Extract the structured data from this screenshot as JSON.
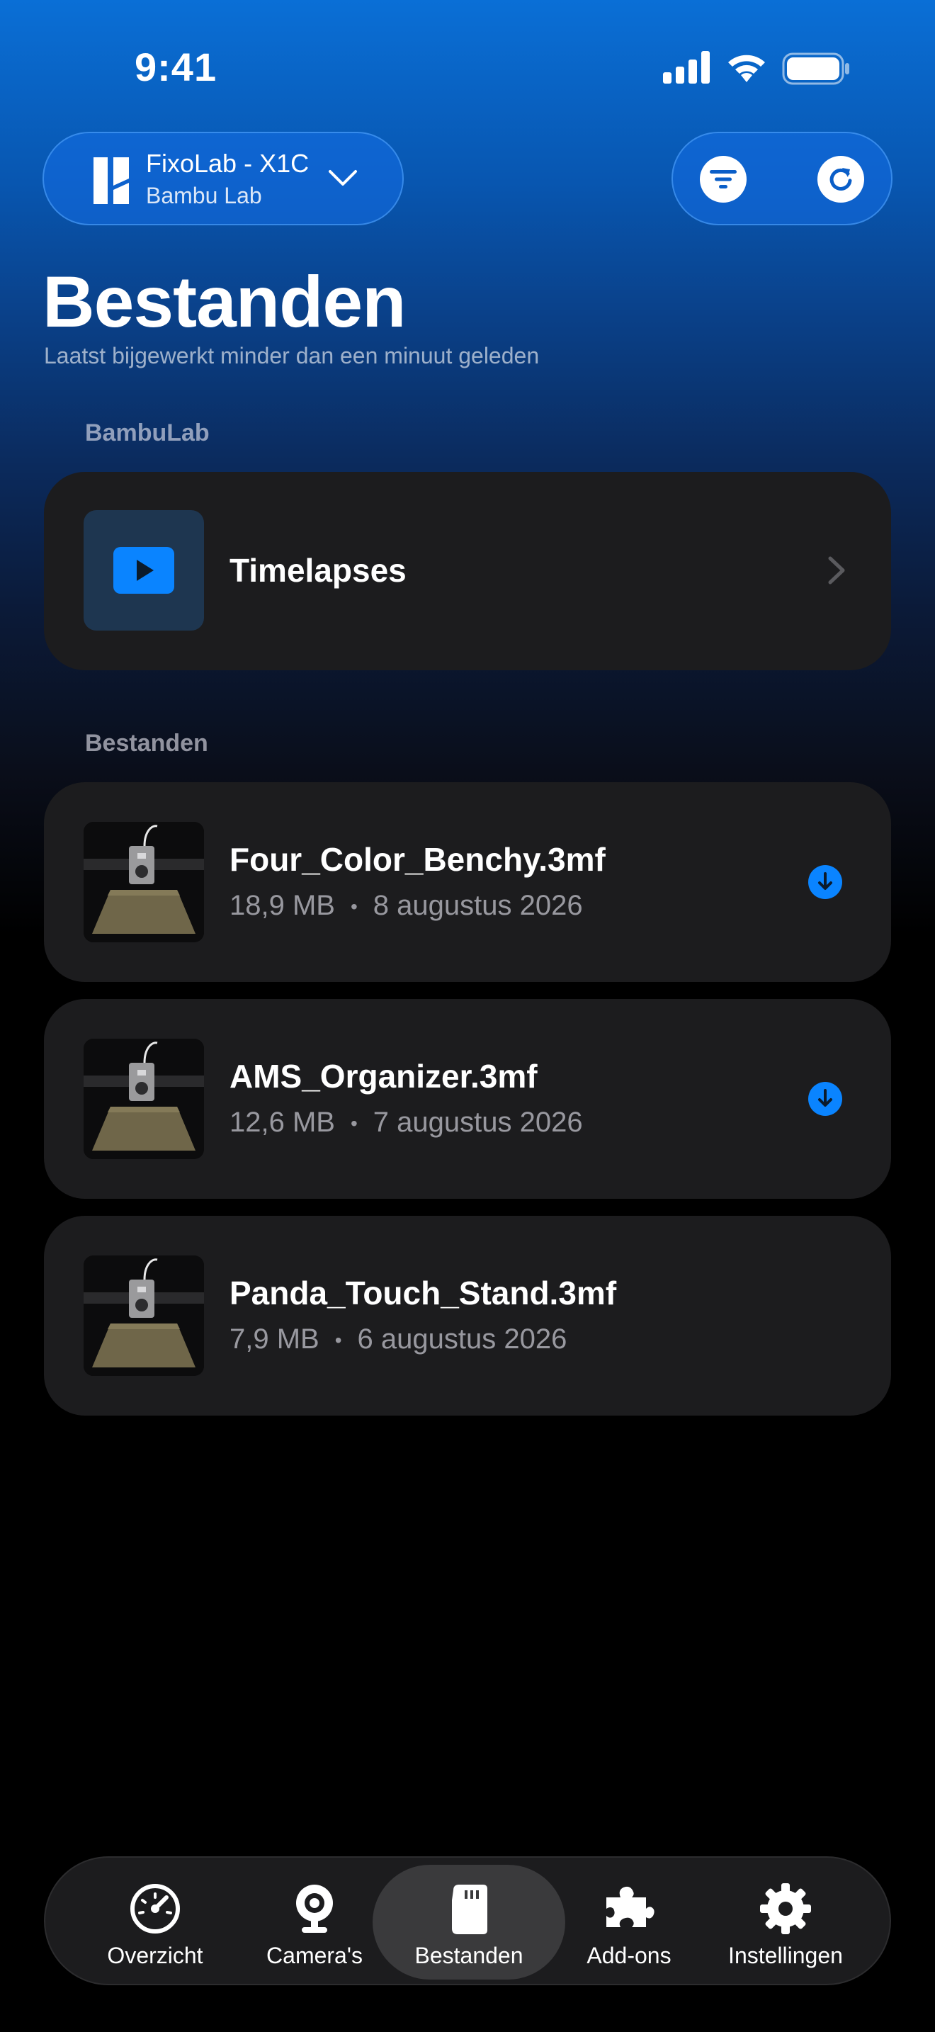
{
  "status_bar": {
    "time": "9:41"
  },
  "device": {
    "name": "FixoLab - X1C",
    "brand": "Bambu Lab"
  },
  "page": {
    "title": "Bestanden",
    "subtitle": "Laatst bijgewerkt minder dan een minuut geleden"
  },
  "sections": {
    "bambulab_label": "BambuLab",
    "files_label": "Bestanden"
  },
  "timelapses": {
    "label": "Timelapses"
  },
  "files": [
    {
      "name": "Four_Color_Benchy.3mf",
      "size": "18,9 MB",
      "separator": "•",
      "date": "8 augustus 2026",
      "downloadable": true
    },
    {
      "name": "AMS_Organizer.3mf",
      "size": "12,6 MB",
      "separator": "•",
      "date": "7 augustus 2026",
      "downloadable": true
    },
    {
      "name": "Panda_Touch_Stand.3mf",
      "size": "7,9 MB",
      "separator": "•",
      "date": "6 augustus 2026",
      "downloadable": false
    }
  ],
  "tabs": [
    {
      "label": "Overzicht",
      "icon": "gauge-icon",
      "active": false
    },
    {
      "label": "Camera's",
      "icon": "webcam-icon",
      "active": false
    },
    {
      "label": "Bestanden",
      "icon": "sd-card-icon",
      "active": true
    },
    {
      "label": "Add-ons",
      "icon": "puzzle-icon",
      "active": false
    },
    {
      "label": "Instellingen",
      "icon": "gear-icon",
      "active": false
    }
  ],
  "colors": {
    "accent": "#0a84ff",
    "card": "#1c1c1e",
    "header_blue": "#0a6fd6"
  }
}
